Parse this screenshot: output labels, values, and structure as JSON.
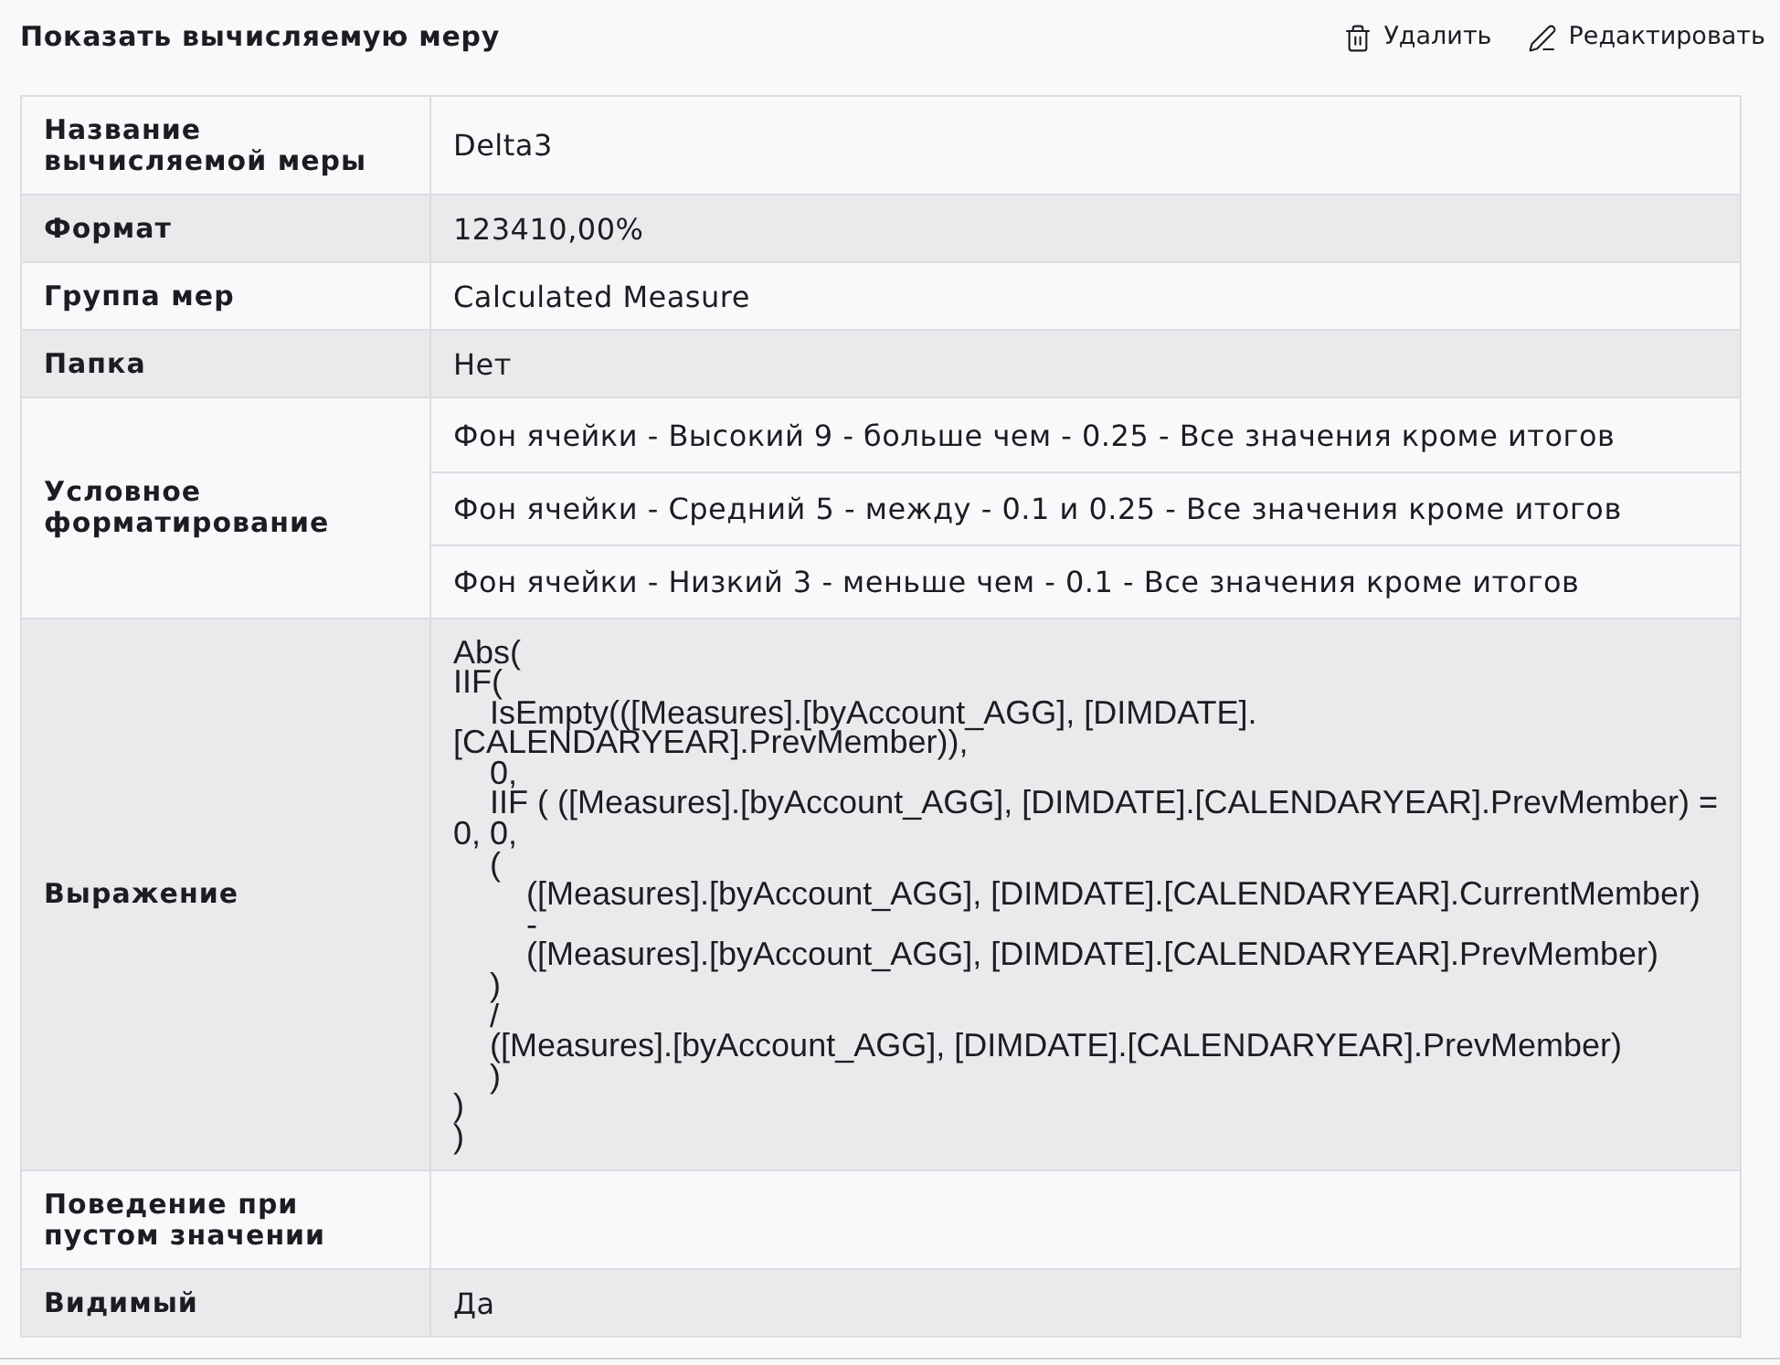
{
  "title": "Показать вычисляемую меру",
  "actions": [
    {
      "kind": "delete",
      "label": "Удалить"
    },
    {
      "kind": "edit",
      "label": "Редактировать"
    }
  ],
  "properties": [
    {
      "kind": "text",
      "label": "Название вычисляемой меры",
      "value": "Delta3"
    },
    {
      "kind": "text",
      "label": "Формат",
      "value": "123410,00%"
    },
    {
      "kind": "text",
      "label": "Группа мер",
      "value": "Calculated Measure"
    },
    {
      "kind": "text",
      "label": "Папка",
      "value": "Нет"
    },
    {
      "kind": "list",
      "label": "Условное форматирование",
      "values": [
        "Фон ячейки - Высокий 9 - больше чем - 0.25 - Все значения кроме итогов",
        "Фон ячейки - Средний 5 - между - 0.1 и 0.25 - Все значения кроме итогов",
        "Фон ячейки - Низкий 3 - меньше чем - 0.1 - Все значения кроме итогов"
      ]
    },
    {
      "kind": "code",
      "label": "Выражение",
      "value": "Abs(\nIIF(\n    IsEmpty(([Measures].[byAccount_AGG], [DIMDATE].\n[CALENDARYEAR].PrevMember)),\n    0,\n    IIF ( ([Measures].[byAccount_AGG], [DIMDATE].[CALENDARYEAR].PrevMember) =\n0, 0,\n    (\n        ([Measures].[byAccount_AGG], [DIMDATE].[CALENDARYEAR].CurrentMember)\n        -\n        ([Measures].[byAccount_AGG], [DIMDATE].[CALENDARYEAR].PrevMember)\n    )\n    /\n    ([Measures].[byAccount_AGG], [DIMDATE].[CALENDARYEAR].PrevMember)\n    )\n)\n)"
    },
    {
      "kind": "text",
      "label": "Поведение при пустом значении"
    },
    {
      "kind": "text",
      "label": "Видимый",
      "value": "Да"
    }
  ]
}
